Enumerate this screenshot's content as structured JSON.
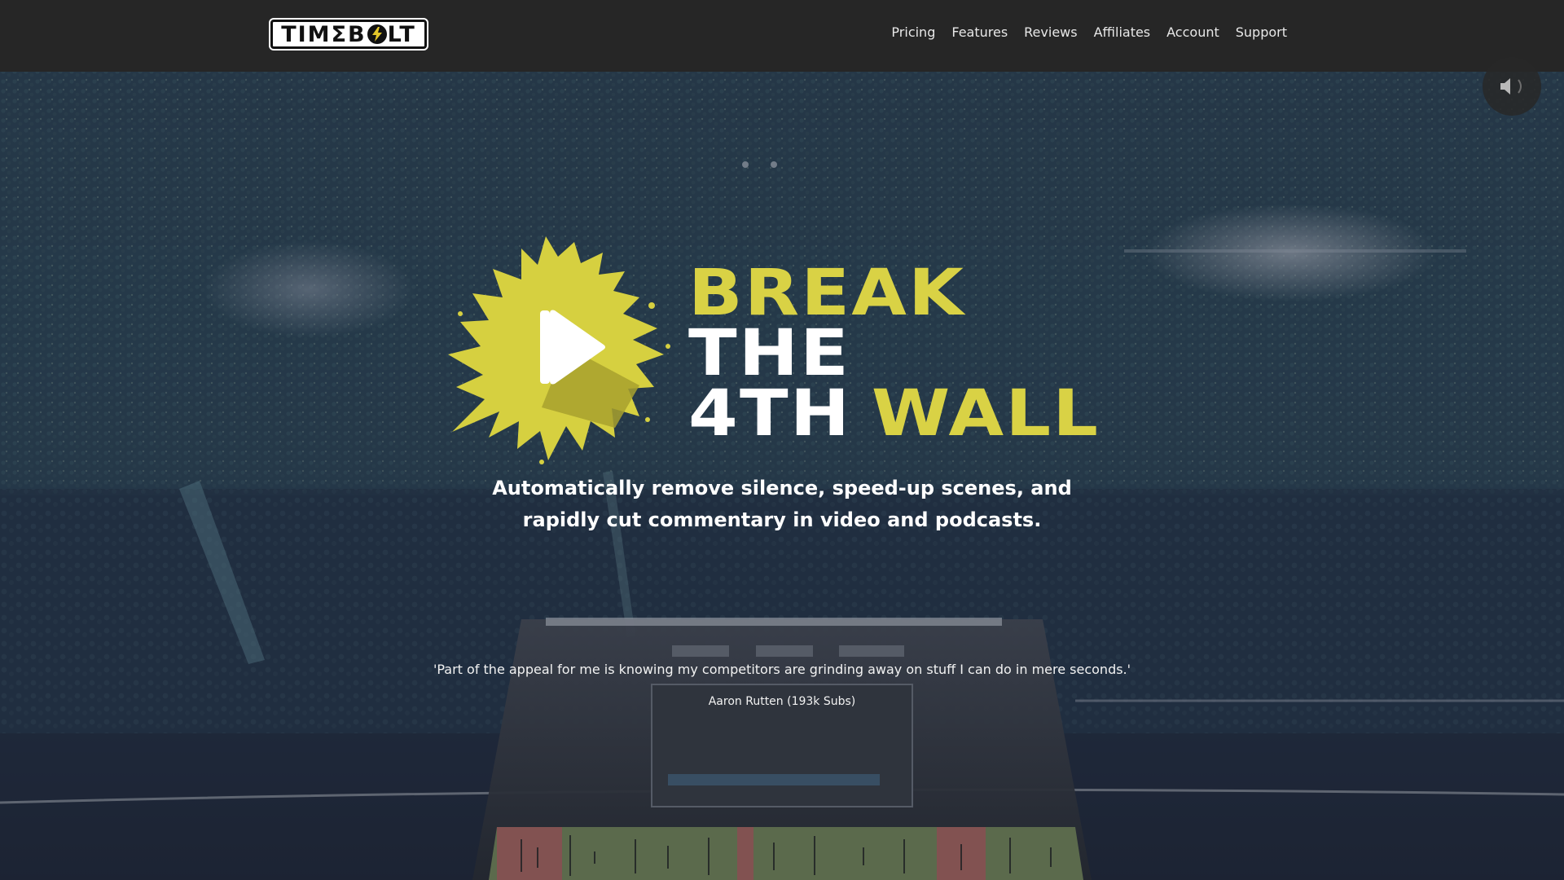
{
  "header": {
    "logo_text_left": "TIM",
    "logo_text_mid": "Σ",
    "logo_text_right": "LT",
    "nav": [
      "Pricing",
      "Features",
      "Reviews",
      "Affiliates",
      "Account",
      "Support"
    ]
  },
  "hero": {
    "headline_line1": "BREAK",
    "headline_line2": "THE",
    "headline_line3a": "4TH",
    "headline_line3b": "WALL",
    "tagline": "Automatically remove silence, speed-up scenes, and rapidly cut commentary in video and podcasts.",
    "quote": "'Part of the appeal for me is knowing my competitors are grinding away on stuff I can do in mere seconds.'",
    "quote_author": "Aaron Rutten (193k Subs)"
  },
  "colors": {
    "accent_yellow": "#d9d245",
    "topbar": "#262626",
    "background_overlay": "#1d2533"
  },
  "icons": {
    "mute": "speaker-muted-icon",
    "play": "play-icon",
    "bolt": "lightning-bolt-icon"
  }
}
